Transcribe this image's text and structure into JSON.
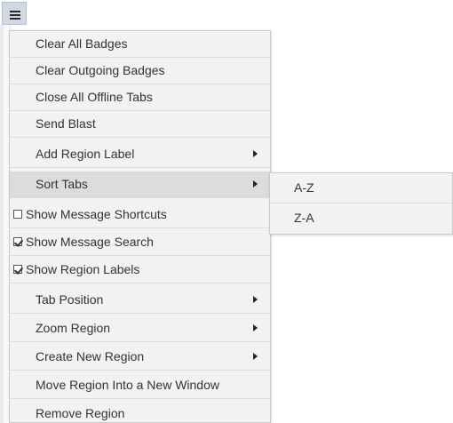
{
  "menu_button": {
    "icon": "hamburger-menu-icon"
  },
  "menu": {
    "items": [
      {
        "label": "Clear All Badges",
        "type": "action"
      },
      {
        "label": "Clear Outgoing Badges",
        "type": "action"
      },
      {
        "label": "Close All Offline Tabs",
        "type": "action"
      },
      {
        "label": "Send Blast",
        "type": "action"
      },
      {
        "label": "Add Region Label",
        "type": "submenu"
      },
      {
        "label": "Sort Tabs",
        "type": "submenu",
        "active": true
      },
      {
        "label": "Show Message Shortcuts",
        "type": "checkbox",
        "checked": false
      },
      {
        "label": "Show Message Search",
        "type": "checkbox",
        "checked": true
      },
      {
        "label": "Show Region Labels",
        "type": "checkbox",
        "checked": true
      },
      {
        "label": "Tab Position",
        "type": "submenu"
      },
      {
        "label": "Zoom Region",
        "type": "submenu"
      },
      {
        "label": "Create New Region",
        "type": "submenu"
      },
      {
        "label": "Move Region Into a New Window",
        "type": "action"
      },
      {
        "label": "Remove Region",
        "type": "action"
      }
    ]
  },
  "submenu": {
    "parent": "Sort Tabs",
    "items": [
      {
        "label": "A-Z"
      },
      {
        "label": "Z-A"
      }
    ]
  },
  "colors": {
    "menu_background": "#f2f2f2",
    "active_item": "#dcdcdc",
    "button_background": "#cfd8e3",
    "text": "#333333"
  }
}
